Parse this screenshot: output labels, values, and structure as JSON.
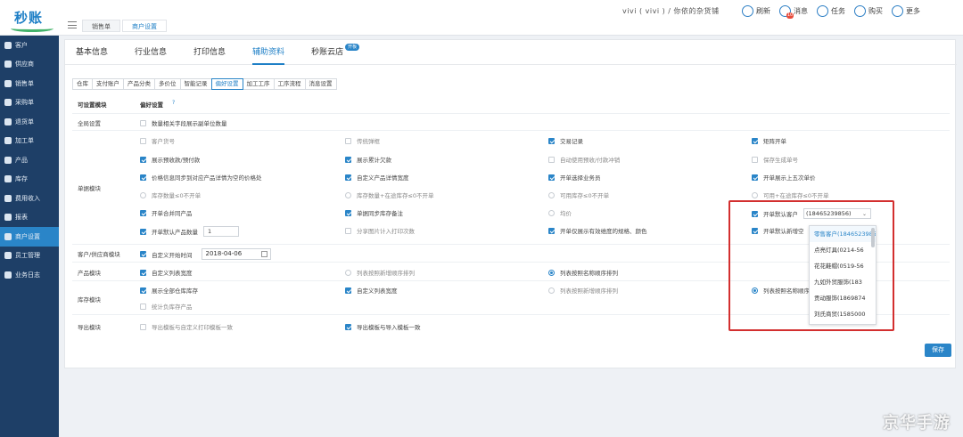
{
  "brand": {
    "logo_text": "秒账"
  },
  "page_tabs": [
    {
      "label": "销售单"
    },
    {
      "label": "商户设置"
    }
  ],
  "user": {
    "greeting": "vivi ( vivi ) / 你依的杂货铺"
  },
  "top_actions": [
    {
      "label": "刷新",
      "icon": "refresh-icon"
    },
    {
      "label": "消息",
      "icon": "message-icon",
      "badge": "10"
    },
    {
      "label": "任务",
      "icon": "task-icon"
    },
    {
      "label": "购买",
      "icon": "cart-icon"
    },
    {
      "label": "更多",
      "icon": "user-icon"
    }
  ],
  "sidebar": {
    "items": [
      {
        "label": "客户"
      },
      {
        "label": "供应商"
      },
      {
        "label": "销售单"
      },
      {
        "label": "采购单"
      },
      {
        "label": "退货单"
      },
      {
        "label": "加工单"
      },
      {
        "label": "产品"
      },
      {
        "label": "库存"
      },
      {
        "label": "费用收入"
      },
      {
        "label": "报表"
      },
      {
        "label": "商户设置"
      },
      {
        "label": "员工管理"
      },
      {
        "label": "业务日志"
      }
    ]
  },
  "main_tabs": [
    {
      "label": "基本信息"
    },
    {
      "label": "行业信息"
    },
    {
      "label": "打印信息"
    },
    {
      "label": "辅助资料"
    },
    {
      "label": "秒账云店",
      "badge": "开板"
    }
  ],
  "sub_tabs": [
    {
      "label": "仓库"
    },
    {
      "label": "支付账户"
    },
    {
      "label": "产品分类"
    },
    {
      "label": "多价位"
    },
    {
      "label": "智能记录"
    },
    {
      "label": "偏好设置"
    },
    {
      "label": "加工工序"
    },
    {
      "label": "工序流程"
    },
    {
      "label": "消息设置"
    }
  ],
  "table": {
    "header_module": "可设置模块",
    "header_pref": "偏好设置",
    "rows": {
      "global": "全局设置",
      "order": "单据模块",
      "supplier": "客户/供应商模块",
      "product": "产品模块",
      "stock": "库存模块",
      "export": "导出模块"
    }
  },
  "options": {
    "global_1": "数量相关字段展示副单位数量",
    "o_r1c1": "客户货号",
    "o_r1c2": "传统弹框",
    "o_r1c3": "交易记录",
    "o_r1c4": "矩阵开单",
    "o_r2c1": "展示预收款/预付款",
    "o_r2c2": "展示累计欠款",
    "o_r2c3": "自动使用预收/付款冲销",
    "o_r2c4": "保存生成单号",
    "o_r3c1": "价格信息同步到对应产品详情为空的价格处",
    "o_r3c2": "自定义产品详情宽度",
    "o_r3c3": "开单选择业务员",
    "o_r3c4": "开单展示上五次单价",
    "o_r4c1": "库存数量≤0不开单",
    "o_r4c2": "库存数量+在途库存≤0不开单",
    "o_r4c3": "可用库存≤0不开单",
    "o_r4c4": "可用+在途库存≤0不开单",
    "o_r5c1": "开单合并同产品",
    "o_r5c2": "单据同步库存备注",
    "o_r5c3": "均价",
    "o_r5c4": "开单默认客户",
    "o_r6c1": "开单默认产品数量",
    "o_r6c1_value": "1",
    "o_r6c2": "分享图片计入打印次数",
    "o_r6c3": "开单仅展示有效维度的规格、颜色",
    "o_r6c4": "开单默认新增空",
    "supplier_1": "自定义开始时间",
    "supplier_date": "2018-04-06",
    "product_1": "自定义列表宽度",
    "product_2": "列表按照新增顺序排列",
    "product_3": "列表按照名称顺序排列",
    "stock_1": "展示全部仓库库存",
    "stock_2": "自定义列表宽度",
    "stock_3": "列表按照新增顺序排列",
    "stock_4": "列表按照名称顺序排",
    "stock_5": "统计负库存产品",
    "export_1": "导出模板与自定义打印模板一致",
    "export_2": "导出模板与导入模板一致"
  },
  "default_customer": {
    "value": "(18465239856)",
    "options": [
      "零售客户(18465239856)",
      "点亮灯具(0214-56",
      "花花鞋帽(0519-56",
      "九如外贸服饰(183",
      "贡动服饰(1869874",
      "刘氏商贸(1585000"
    ]
  },
  "save_label": "保存",
  "watermark": "京华手游",
  "colors": {
    "sidebar": "#1e3f67",
    "accent": "#2a85c8",
    "highlight": "#d32f2f"
  }
}
